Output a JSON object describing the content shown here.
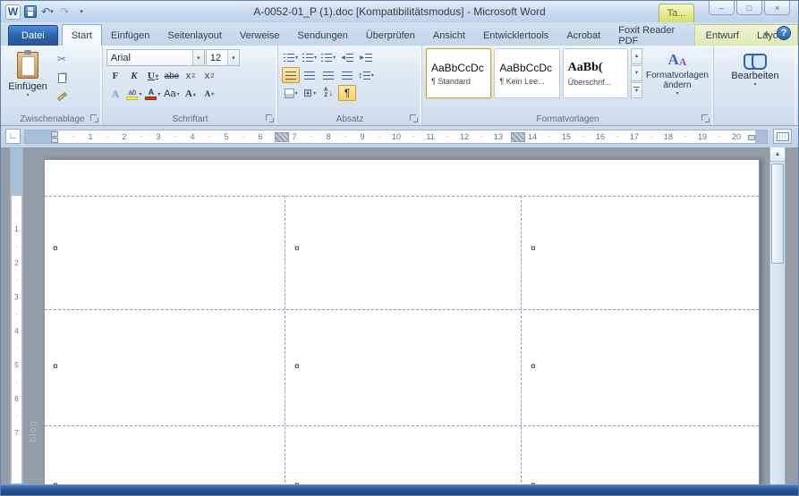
{
  "window": {
    "title": "A-0052-01_P (1).doc [Kompatibilitätsmodus]  -  Microsoft Word"
  },
  "icons": {
    "word": "W",
    "undo": "↶",
    "redo": "↷",
    "dropdown": "▾",
    "grow_mark": "▴",
    "shrink_mark": "▾",
    "scissors": "✂",
    "minimize": "–",
    "restore": "□",
    "close": "×",
    "collapse": "∧",
    "help": "?",
    "up_arrow": "▲",
    "down_arrow": "▼",
    "left_tri": "◀",
    "right_tri": "▶",
    "updown": "↕",
    "grid": "⊞",
    "sort_arrow": "↓",
    "corner": "∟",
    "dot": "·"
  },
  "tabs": {
    "file_label": "Datei",
    "items": [
      {
        "label": "Start",
        "active": true
      },
      {
        "label": "Einfügen"
      },
      {
        "label": "Seitenlayout"
      },
      {
        "label": "Verweise"
      },
      {
        "label": "Sendungen"
      },
      {
        "label": "Überprüfen"
      },
      {
        "label": "Ansicht"
      },
      {
        "label": "Entwicklertools"
      },
      {
        "label": "Acrobat"
      },
      {
        "label": "Foxit Reader PDF"
      }
    ],
    "contextual_header": "Ta...",
    "contextual": [
      {
        "label": "Entwurf"
      },
      {
        "label": "Layout"
      }
    ]
  },
  "ribbon": {
    "clipboard": {
      "group_label": "Zwischenablage",
      "paste_label": "Einfügen"
    },
    "font": {
      "group_label": "Schriftart",
      "font_name": "Arial",
      "font_size": "12",
      "bold": "F",
      "italic": "K",
      "underline": "U",
      "strikethrough": "abe",
      "subscript_base": "x",
      "subscript_mark": "2",
      "superscript_base": "x",
      "superscript_mark": "2",
      "text_effects": "A",
      "highlight": "ab",
      "font_color": "A",
      "change_case": "Aa",
      "grow": "A",
      "shrink": "A"
    },
    "paragraph": {
      "group_label": "Absatz",
      "sort_a": "A",
      "sort_z": "Z",
      "paragraph_mark": "¶"
    },
    "styles": {
      "group_label": "Formatvorlagen",
      "items": [
        {
          "preview": "AaBbCcDc",
          "name": "¶ Standard"
        },
        {
          "preview": "AaBbCcDc",
          "name": "¶ Kein Lee..."
        },
        {
          "preview": "AaBb(",
          "name": "Überschrif..."
        }
      ],
      "change_label": "Formatvorlagen ändern"
    },
    "editing": {
      "group_label": "Bearbeiten"
    }
  },
  "ruler": {
    "horizontal": [
      "1",
      "2",
      "3",
      "4",
      "5",
      "6",
      "7",
      "8",
      "9",
      "10",
      "11",
      "12",
      "13",
      "14",
      "15",
      "16",
      "17",
      "18",
      "19",
      "20"
    ],
    "vertical": [
      "1",
      "2",
      "3",
      "4",
      "5",
      "6",
      "7"
    ]
  },
  "document": {
    "watermark": "blog",
    "table": {
      "rows": [
        [
          "¤",
          "¤",
          "¤"
        ],
        [
          "¤",
          "¤",
          "¤"
        ],
        [
          "¤",
          "¤",
          "¤"
        ]
      ]
    }
  }
}
